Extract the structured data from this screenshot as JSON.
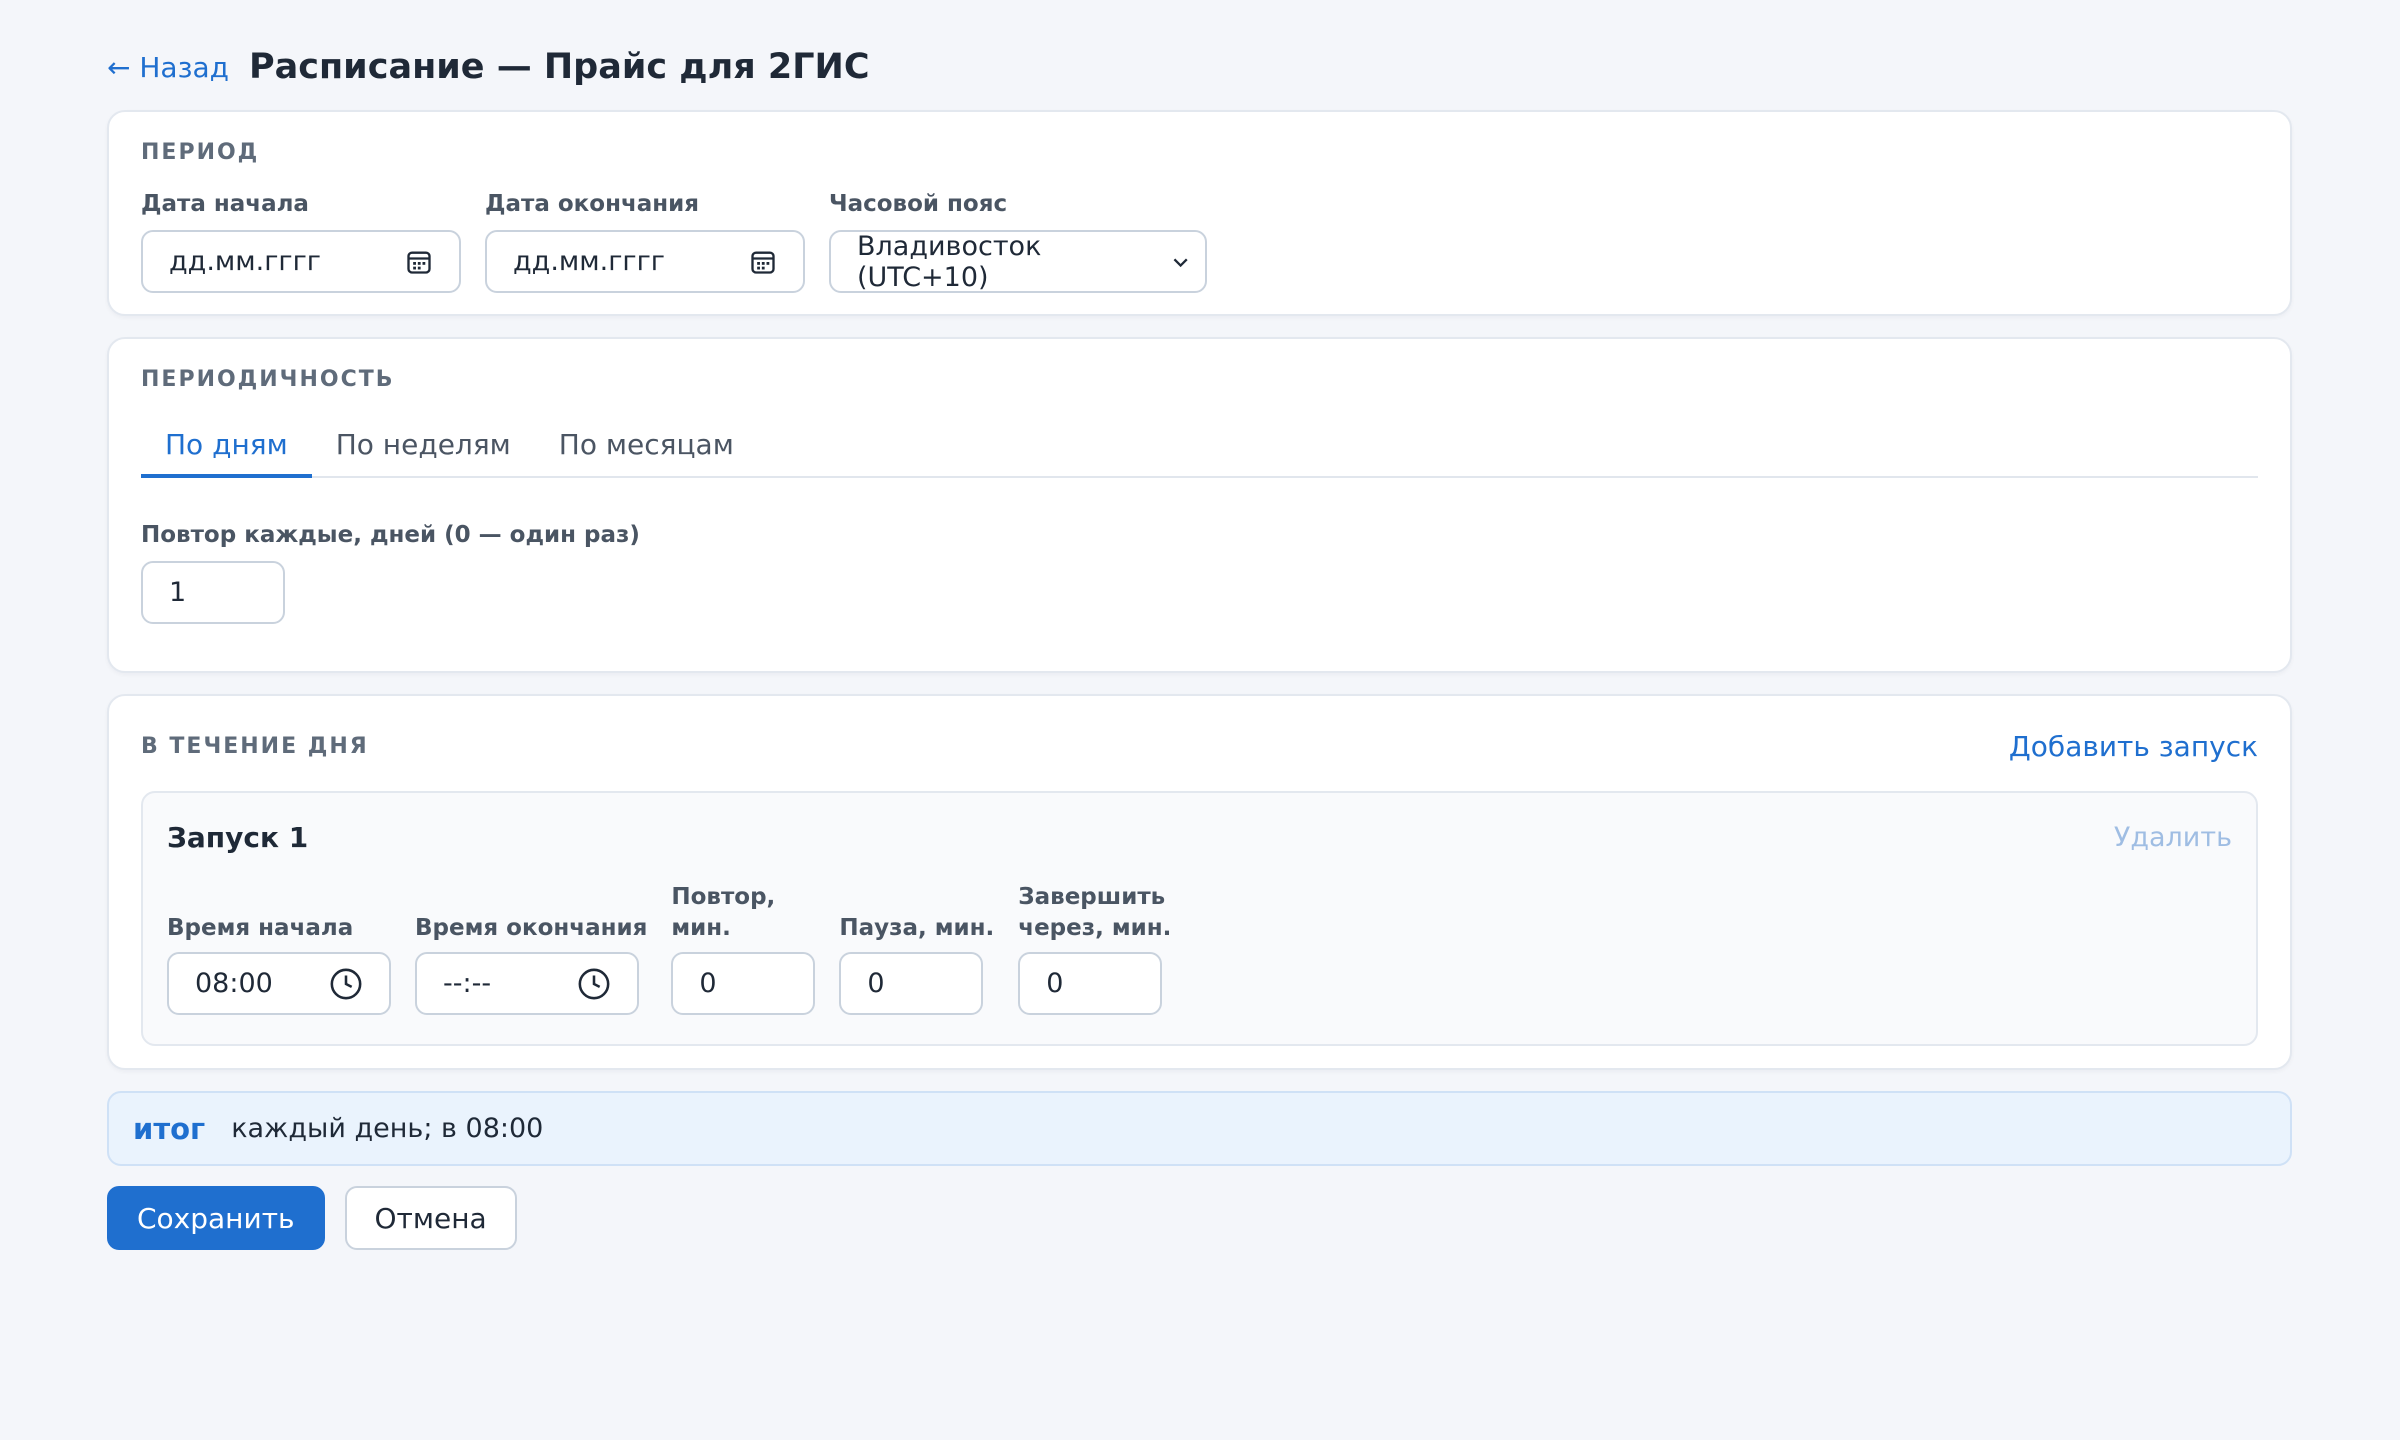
{
  "header": {
    "back_label": "← Назад",
    "title": "Расписание — Прайс для 2ГИС"
  },
  "period": {
    "section_title": "ПЕРИОД",
    "start_label": "Дата начала",
    "start_value": "дд.мм.гггг",
    "end_label": "Дата окончания",
    "end_value": "дд.мм.гггг",
    "tz_label": "Часовой пояс",
    "tz_value": "Владивосток (UTC+10)"
  },
  "recurrence": {
    "section_title": "ПЕРИОДИЧНОСТЬ",
    "tabs": [
      {
        "label": "По дням",
        "active": true
      },
      {
        "label": "По неделям",
        "active": false
      },
      {
        "label": "По месяцам",
        "active": false
      }
    ],
    "repeat_label": "Повтор каждые, дней (0 — один раз)",
    "repeat_value": "1"
  },
  "day": {
    "section_title": "В ТЕЧЕНИЕ ДНЯ",
    "add_label": "Добавить запуск",
    "launch": {
      "title": "Запуск 1",
      "delete_label": "Удалить",
      "start_time_label": "Время начала",
      "start_time_value": "08:00",
      "end_time_label": "Время окончания",
      "end_time_value": "--:--",
      "repeat_label_1": "Повтор,",
      "repeat_label_2": "мин.",
      "repeat_value": "0",
      "pause_label": "Пауза, мин.",
      "pause_value": "0",
      "finish_label_1": "Завершить",
      "finish_label_2": "через, мин.",
      "finish_value": "0"
    }
  },
  "summary": {
    "label": "итог",
    "text": "каждый день; в 08:00"
  },
  "actions": {
    "save_label": "Сохранить",
    "cancel_label": "Отмена"
  },
  "colors": {
    "accent": "#1f6fcf",
    "background": "#f4f6fa",
    "summary_bg": "#eaf3fd"
  }
}
